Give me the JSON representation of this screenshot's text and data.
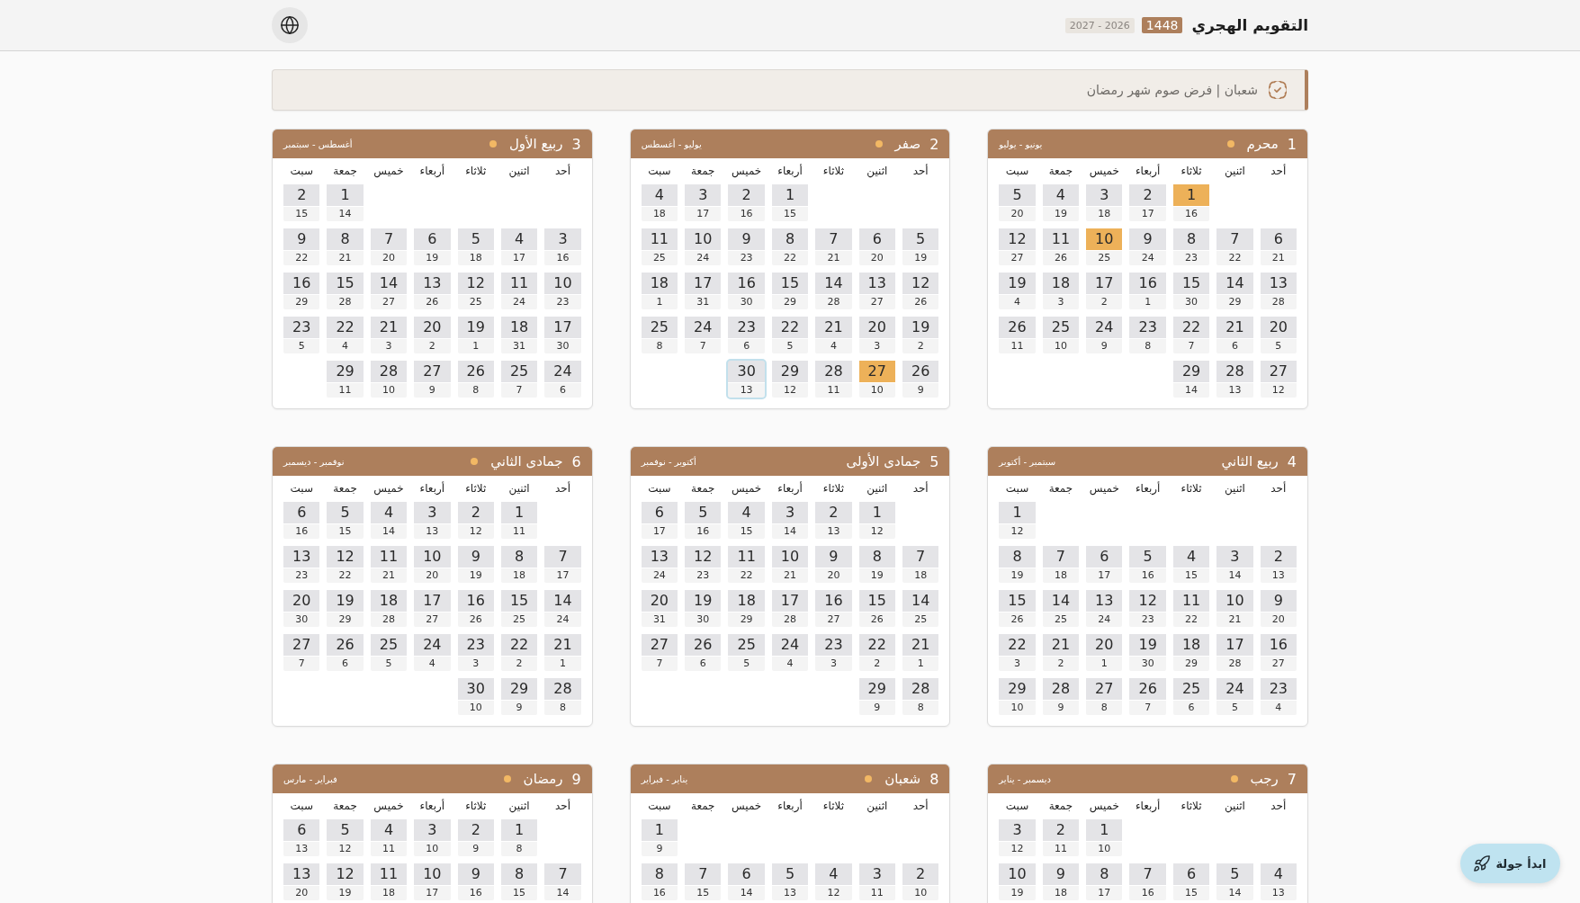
{
  "header": {
    "title": "التقويم الهجري",
    "hijri_year": "1448",
    "gregorian_years": "2026 - 2027"
  },
  "banner": {
    "text": "شعبان | فرض صوم شهر رمضان"
  },
  "months": [
    {
      "number": "1",
      "name": "محرم",
      "marked": true,
      "gregorian_range": "يونيو - يوليو",
      "weekdays": [
        "أحد",
        "اثنين",
        "ثلاثاء",
        "أربعاء",
        "خميس",
        "جمعة",
        "سبت"
      ],
      "weeks": [
        [
          {
            "hijri": "1",
            "gregorian": "16",
            "kind": "event"
          },
          {
            "hijri": "2",
            "gregorian": "17",
            "kind": "day"
          },
          {
            "hijri": "3",
            "gregorian": "18",
            "kind": "day"
          },
          {
            "hijri": "4",
            "gregorian": "19",
            "kind": "day"
          },
          {
            "hijri": "5",
            "gregorian": "20",
            "kind": "day"
          }
        ],
        [
          {
            "hijri": "6",
            "gregorian": "21",
            "kind": "day"
          },
          {
            "hijri": "7",
            "gregorian": "22",
            "kind": "day"
          },
          {
            "hijri": "8",
            "gregorian": "23",
            "kind": "day"
          },
          {
            "hijri": "9",
            "gregorian": "24",
            "kind": "day"
          },
          {
            "hijri": "10",
            "gregorian": "25",
            "kind": "event"
          },
          {
            "hijri": "11",
            "gregorian": "26",
            "kind": "day"
          },
          {
            "hijri": "12",
            "gregorian": "27",
            "kind": "day"
          }
        ],
        [
          {
            "hijri": "13",
            "gregorian": "28",
            "kind": "day"
          },
          {
            "hijri": "14",
            "gregorian": "29",
            "kind": "day"
          },
          {
            "hijri": "15",
            "gregorian": "30",
            "kind": "day"
          },
          {
            "hijri": "16",
            "gregorian": "1",
            "kind": "day"
          },
          {
            "hijri": "17",
            "gregorian": "2",
            "kind": "day"
          },
          {
            "hijri": "18",
            "gregorian": "3",
            "kind": "day"
          },
          {
            "hijri": "19",
            "gregorian": "4",
            "kind": "day"
          }
        ],
        [
          {
            "hijri": "20",
            "gregorian": "5",
            "kind": "day"
          },
          {
            "hijri": "21",
            "gregorian": "6",
            "kind": "day"
          },
          {
            "hijri": "22",
            "gregorian": "7",
            "kind": "day"
          },
          {
            "hijri": "23",
            "gregorian": "8",
            "kind": "day"
          },
          {
            "hijri": "24",
            "gregorian": "9",
            "kind": "day"
          },
          {
            "hijri": "25",
            "gregorian": "10",
            "kind": "day"
          },
          {
            "hijri": "26",
            "gregorian": "11",
            "kind": "day"
          }
        ],
        [
          {
            "hijri": "27",
            "gregorian": "12",
            "kind": "day"
          },
          {
            "hijri": "28",
            "gregorian": "13",
            "kind": "day"
          },
          {
            "hijri": "29",
            "gregorian": "14",
            "kind": "day"
          }
        ]
      ]
    },
    {
      "number": "2",
      "name": "صفر",
      "marked": true,
      "gregorian_range": "يوليو - أغسطس",
      "weekdays": [
        "أحد",
        "اثنين",
        "ثلاثاء",
        "أربعاء",
        "خميس",
        "جمعة",
        "سبت"
      ],
      "weeks": [
        [
          {
            "hijri": "1",
            "gregorian": "15",
            "kind": "day"
          },
          {
            "hijri": "2",
            "gregorian": "16",
            "kind": "day"
          },
          {
            "hijri": "3",
            "gregorian": "17",
            "kind": "day"
          },
          {
            "hijri": "4",
            "gregorian": "18",
            "kind": "day"
          }
        ],
        [
          {
            "hijri": "5",
            "gregorian": "19",
            "kind": "day"
          },
          {
            "hijri": "6",
            "gregorian": "20",
            "kind": "day"
          },
          {
            "hijri": "7",
            "gregorian": "21",
            "kind": "day"
          },
          {
            "hijri": "8",
            "gregorian": "22",
            "kind": "day"
          },
          {
            "hijri": "9",
            "gregorian": "23",
            "kind": "day"
          },
          {
            "hijri": "10",
            "gregorian": "24",
            "kind": "day"
          },
          {
            "hijri": "11",
            "gregorian": "25",
            "kind": "day"
          }
        ],
        [
          {
            "hijri": "12",
            "gregorian": "26",
            "kind": "day"
          },
          {
            "hijri": "13",
            "gregorian": "27",
            "kind": "day"
          },
          {
            "hijri": "14",
            "gregorian": "28",
            "kind": "day"
          },
          {
            "hijri": "15",
            "gregorian": "29",
            "kind": "day"
          },
          {
            "hijri": "16",
            "gregorian": "30",
            "kind": "day"
          },
          {
            "hijri": "17",
            "gregorian": "31",
            "kind": "day"
          },
          {
            "hijri": "18",
            "gregorian": "1",
            "kind": "day"
          }
        ],
        [
          {
            "hijri": "19",
            "gregorian": "2",
            "kind": "day"
          },
          {
            "hijri": "20",
            "gregorian": "3",
            "kind": "day"
          },
          {
            "hijri": "21",
            "gregorian": "4",
            "kind": "day"
          },
          {
            "hijri": "22",
            "gregorian": "5",
            "kind": "day"
          },
          {
            "hijri": "23",
            "gregorian": "6",
            "kind": "day"
          },
          {
            "hijri": "24",
            "gregorian": "7",
            "kind": "day"
          },
          {
            "hijri": "25",
            "gregorian": "8",
            "kind": "day"
          }
        ],
        [
          {
            "hijri": "26",
            "gregorian": "9",
            "kind": "day"
          },
          {
            "hijri": "27",
            "gregorian": "10",
            "kind": "event"
          },
          {
            "hijri": "28",
            "gregorian": "11",
            "kind": "day"
          },
          {
            "hijri": "29",
            "gregorian": "12",
            "kind": "day"
          },
          {
            "hijri": "30",
            "gregorian": "13",
            "kind": "today"
          }
        ]
      ]
    },
    {
      "number": "3",
      "name": "ربيع الأول",
      "marked": true,
      "gregorian_range": "أغسطس - سبتمبر",
      "weekdays": [
        "أحد",
        "اثنين",
        "ثلاثاء",
        "أربعاء",
        "خميس",
        "جمعة",
        "سبت"
      ],
      "weeks": [
        [
          {
            "hijri": "1",
            "gregorian": "14",
            "kind": "day"
          },
          {
            "hijri": "2",
            "gregorian": "15",
            "kind": "day"
          }
        ],
        [
          {
            "hijri": "3",
            "gregorian": "16",
            "kind": "day"
          },
          {
            "hijri": "4",
            "gregorian": "17",
            "kind": "day"
          },
          {
            "hijri": "5",
            "gregorian": "18",
            "kind": "day"
          },
          {
            "hijri": "6",
            "gregorian": "19",
            "kind": "day"
          },
          {
            "hijri": "7",
            "gregorian": "20",
            "kind": "day"
          },
          {
            "hijri": "8",
            "gregorian": "21",
            "kind": "day"
          },
          {
            "hijri": "9",
            "gregorian": "22",
            "kind": "day"
          }
        ],
        [
          {
            "hijri": "10",
            "gregorian": "23",
            "kind": "day"
          },
          {
            "hijri": "11",
            "gregorian": "24",
            "kind": "day"
          },
          {
            "hijri": "12",
            "gregorian": "25",
            "kind": "day"
          },
          {
            "hijri": "13",
            "gregorian": "26",
            "kind": "day"
          },
          {
            "hijri": "14",
            "gregorian": "27",
            "kind": "day"
          },
          {
            "hijri": "15",
            "gregorian": "28",
            "kind": "day"
          },
          {
            "hijri": "16",
            "gregorian": "29",
            "kind": "day"
          }
        ],
        [
          {
            "hijri": "17",
            "gregorian": "30",
            "kind": "day"
          },
          {
            "hijri": "18",
            "gregorian": "31",
            "kind": "day"
          },
          {
            "hijri": "19",
            "gregorian": "1",
            "kind": "day"
          },
          {
            "hijri": "20",
            "gregorian": "2",
            "kind": "day"
          },
          {
            "hijri": "21",
            "gregorian": "3",
            "kind": "day"
          },
          {
            "hijri": "22",
            "gregorian": "4",
            "kind": "day"
          },
          {
            "hijri": "23",
            "gregorian": "5",
            "kind": "day"
          }
        ],
        [
          {
            "hijri": "24",
            "gregorian": "6",
            "kind": "day"
          },
          {
            "hijri": "25",
            "gregorian": "7",
            "kind": "day"
          },
          {
            "hijri": "26",
            "gregorian": "8",
            "kind": "day"
          },
          {
            "hijri": "27",
            "gregorian": "9",
            "kind": "day"
          },
          {
            "hijri": "28",
            "gregorian": "10",
            "kind": "day"
          },
          {
            "hijri": "29",
            "gregorian": "11",
            "kind": "day"
          }
        ]
      ]
    },
    {
      "number": "4",
      "name": "ربيع الثاني",
      "marked": false,
      "gregorian_range": "سبتمبر - أكتوبر",
      "weekdays": [
        "أحد",
        "اثنين",
        "ثلاثاء",
        "أربعاء",
        "خميس",
        "جمعة",
        "سبت"
      ],
      "weeks": [
        [
          {
            "hijri": "1",
            "gregorian": "12",
            "kind": "day"
          }
        ],
        [
          {
            "hijri": "2",
            "gregorian": "13",
            "kind": "day"
          },
          {
            "hijri": "3",
            "gregorian": "14",
            "kind": "day"
          },
          {
            "hijri": "4",
            "gregorian": "15",
            "kind": "day"
          },
          {
            "hijri": "5",
            "gregorian": "16",
            "kind": "day"
          },
          {
            "hijri": "6",
            "gregorian": "17",
            "kind": "day"
          },
          {
            "hijri": "7",
            "gregorian": "18",
            "kind": "day"
          },
          {
            "hijri": "8",
            "gregorian": "19",
            "kind": "day"
          }
        ],
        [
          {
            "hijri": "9",
            "gregorian": "20",
            "kind": "day"
          },
          {
            "hijri": "10",
            "gregorian": "21",
            "kind": "day"
          },
          {
            "hijri": "11",
            "gregorian": "22",
            "kind": "day"
          },
          {
            "hijri": "12",
            "gregorian": "23",
            "kind": "day"
          },
          {
            "hijri": "13",
            "gregorian": "24",
            "kind": "day"
          },
          {
            "hijri": "14",
            "gregorian": "25",
            "kind": "day"
          },
          {
            "hijri": "15",
            "gregorian": "26",
            "kind": "day"
          }
        ],
        [
          {
            "hijri": "16",
            "gregorian": "27",
            "kind": "day"
          },
          {
            "hijri": "17",
            "gregorian": "28",
            "kind": "day"
          },
          {
            "hijri": "18",
            "gregorian": "29",
            "kind": "day"
          },
          {
            "hijri": "19",
            "gregorian": "30",
            "kind": "day"
          },
          {
            "hijri": "20",
            "gregorian": "1",
            "kind": "day"
          },
          {
            "hijri": "21",
            "gregorian": "2",
            "kind": "day"
          },
          {
            "hijri": "22",
            "gregorian": "3",
            "kind": "day"
          }
        ],
        [
          {
            "hijri": "23",
            "gregorian": "4",
            "kind": "day"
          },
          {
            "hijri": "24",
            "gregorian": "5",
            "kind": "day"
          },
          {
            "hijri": "25",
            "gregorian": "6",
            "kind": "day"
          },
          {
            "hijri": "26",
            "gregorian": "7",
            "kind": "day"
          },
          {
            "hijri": "27",
            "gregorian": "8",
            "kind": "day"
          },
          {
            "hijri": "28",
            "gregorian": "9",
            "kind": "day"
          },
          {
            "hijri": "29",
            "gregorian": "10",
            "kind": "day"
          }
        ]
      ]
    },
    {
      "number": "5",
      "name": "جمادى الأولى",
      "marked": false,
      "gregorian_range": "أكتوبر - نوفمبر",
      "weekdays": [
        "أحد",
        "اثنين",
        "ثلاثاء",
        "أربعاء",
        "خميس",
        "جمعة",
        "سبت"
      ],
      "weeks": [
        [
          {
            "hijri": "1",
            "gregorian": "12",
            "kind": "day"
          },
          {
            "hijri": "2",
            "gregorian": "13",
            "kind": "day"
          },
          {
            "hijri": "3",
            "gregorian": "14",
            "kind": "day"
          },
          {
            "hijri": "4",
            "gregorian": "15",
            "kind": "day"
          },
          {
            "hijri": "5",
            "gregorian": "16",
            "kind": "day"
          },
          {
            "hijri": "6",
            "gregorian": "17",
            "kind": "day"
          }
        ],
        [
          {
            "hijri": "7",
            "gregorian": "18",
            "kind": "day"
          },
          {
            "hijri": "8",
            "gregorian": "19",
            "kind": "day"
          },
          {
            "hijri": "9",
            "gregorian": "20",
            "kind": "day"
          },
          {
            "hijri": "10",
            "gregorian": "21",
            "kind": "day"
          },
          {
            "hijri": "11",
            "gregorian": "22",
            "kind": "day"
          },
          {
            "hijri": "12",
            "gregorian": "23",
            "kind": "day"
          },
          {
            "hijri": "13",
            "gregorian": "24",
            "kind": "day"
          }
        ],
        [
          {
            "hijri": "14",
            "gregorian": "25",
            "kind": "day"
          },
          {
            "hijri": "15",
            "gregorian": "26",
            "kind": "day"
          },
          {
            "hijri": "16",
            "gregorian": "27",
            "kind": "day"
          },
          {
            "hijri": "17",
            "gregorian": "28",
            "kind": "day"
          },
          {
            "hijri": "18",
            "gregorian": "29",
            "kind": "day"
          },
          {
            "hijri": "19",
            "gregorian": "30",
            "kind": "day"
          },
          {
            "hijri": "20",
            "gregorian": "31",
            "kind": "day"
          }
        ],
        [
          {
            "hijri": "21",
            "gregorian": "1",
            "kind": "day"
          },
          {
            "hijri": "22",
            "gregorian": "2",
            "kind": "day"
          },
          {
            "hijri": "23",
            "gregorian": "3",
            "kind": "day"
          },
          {
            "hijri": "24",
            "gregorian": "4",
            "kind": "day"
          },
          {
            "hijri": "25",
            "gregorian": "5",
            "kind": "day"
          },
          {
            "hijri": "26",
            "gregorian": "6",
            "kind": "day"
          },
          {
            "hijri": "27",
            "gregorian": "7",
            "kind": "day"
          }
        ],
        [
          {
            "hijri": "28",
            "gregorian": "8",
            "kind": "day"
          },
          {
            "hijri": "29",
            "gregorian": "9",
            "kind": "day"
          }
        ]
      ]
    },
    {
      "number": "6",
      "name": "جمادى الثاني",
      "marked": true,
      "gregorian_range": "نوفمبر - ديسمبر",
      "weekdays": [
        "أحد",
        "اثنين",
        "ثلاثاء",
        "أربعاء",
        "خميس",
        "جمعة",
        "سبت"
      ],
      "weeks": [
        [
          {
            "hijri": "1",
            "gregorian": "11",
            "kind": "day"
          },
          {
            "hijri": "2",
            "gregorian": "12",
            "kind": "day"
          },
          {
            "hijri": "3",
            "gregorian": "13",
            "kind": "day"
          },
          {
            "hijri": "4",
            "gregorian": "14",
            "kind": "day"
          },
          {
            "hijri": "5",
            "gregorian": "15",
            "kind": "day"
          },
          {
            "hijri": "6",
            "gregorian": "16",
            "kind": "day"
          }
        ],
        [
          {
            "hijri": "7",
            "gregorian": "17",
            "kind": "day"
          },
          {
            "hijri": "8",
            "gregorian": "18",
            "kind": "day"
          },
          {
            "hijri": "9",
            "gregorian": "19",
            "kind": "day"
          },
          {
            "hijri": "10",
            "gregorian": "20",
            "kind": "day"
          },
          {
            "hijri": "11",
            "gregorian": "21",
            "kind": "day"
          },
          {
            "hijri": "12",
            "gregorian": "22",
            "kind": "day"
          },
          {
            "hijri": "13",
            "gregorian": "23",
            "kind": "day"
          }
        ],
        [
          {
            "hijri": "14",
            "gregorian": "24",
            "kind": "day"
          },
          {
            "hijri": "15",
            "gregorian": "25",
            "kind": "day"
          },
          {
            "hijri": "16",
            "gregorian": "26",
            "kind": "day"
          },
          {
            "hijri": "17",
            "gregorian": "27",
            "kind": "day"
          },
          {
            "hijri": "18",
            "gregorian": "28",
            "kind": "day"
          },
          {
            "hijri": "19",
            "gregorian": "29",
            "kind": "day"
          },
          {
            "hijri": "20",
            "gregorian": "30",
            "kind": "day"
          }
        ],
        [
          {
            "hijri": "21",
            "gregorian": "1",
            "kind": "day"
          },
          {
            "hijri": "22",
            "gregorian": "2",
            "kind": "day"
          },
          {
            "hijri": "23",
            "gregorian": "3",
            "kind": "day"
          },
          {
            "hijri": "24",
            "gregorian": "4",
            "kind": "day"
          },
          {
            "hijri": "25",
            "gregorian": "5",
            "kind": "day"
          },
          {
            "hijri": "26",
            "gregorian": "6",
            "kind": "day"
          },
          {
            "hijri": "27",
            "gregorian": "7",
            "kind": "day"
          }
        ],
        [
          {
            "hijri": "28",
            "gregorian": "8",
            "kind": "day"
          },
          {
            "hijri": "29",
            "gregorian": "9",
            "kind": "day"
          },
          {
            "hijri": "30",
            "gregorian": "10",
            "kind": "day"
          }
        ]
      ]
    },
    {
      "number": "7",
      "name": "رجب",
      "marked": true,
      "gregorian_range": "ديسمبر - يناير",
      "weekdays": [
        "أحد",
        "اثنين",
        "ثلاثاء",
        "أربعاء",
        "خميس",
        "جمعة",
        "سبت"
      ],
      "weeks": [
        [
          {
            "hijri": "1",
            "gregorian": "10",
            "kind": "day"
          },
          {
            "hijri": "2",
            "gregorian": "11",
            "kind": "day"
          },
          {
            "hijri": "3",
            "gregorian": "12",
            "kind": "day"
          }
        ],
        [
          {
            "hijri": "4",
            "gregorian": "13",
            "kind": "day"
          },
          {
            "hijri": "5",
            "gregorian": "14",
            "kind": "day"
          },
          {
            "hijri": "6",
            "gregorian": "15",
            "kind": "day"
          },
          {
            "hijri": "7",
            "gregorian": "16",
            "kind": "day"
          },
          {
            "hijri": "8",
            "gregorian": "17",
            "kind": "day"
          },
          {
            "hijri": "9",
            "gregorian": "18",
            "kind": "day"
          },
          {
            "hijri": "10",
            "gregorian": "19",
            "kind": "day"
          }
        ]
      ]
    },
    {
      "number": "8",
      "name": "شعبان",
      "marked": true,
      "gregorian_range": "يناير - فبراير",
      "weekdays": [
        "أحد",
        "اثنين",
        "ثلاثاء",
        "أربعاء",
        "خميس",
        "جمعة",
        "سبت"
      ],
      "weeks": [
        [
          {
            "hijri": "1",
            "gregorian": "9",
            "kind": "day"
          }
        ],
        [
          {
            "hijri": "2",
            "gregorian": "10",
            "kind": "day"
          },
          {
            "hijri": "3",
            "gregorian": "11",
            "kind": "day"
          },
          {
            "hijri": "4",
            "gregorian": "12",
            "kind": "day"
          },
          {
            "hijri": "5",
            "gregorian": "13",
            "kind": "day"
          },
          {
            "hijri": "6",
            "gregorian": "14",
            "kind": "day"
          },
          {
            "hijri": "7",
            "gregorian": "15",
            "kind": "day"
          },
          {
            "hijri": "8",
            "gregorian": "16",
            "kind": "day"
          }
        ]
      ]
    },
    {
      "number": "9",
      "name": "رمضان",
      "marked": true,
      "gregorian_range": "فبراير - مارس",
      "weekdays": [
        "أحد",
        "اثنين",
        "ثلاثاء",
        "أربعاء",
        "خميس",
        "جمعة",
        "سبت"
      ],
      "weeks": [
        [
          {
            "hijri": "1",
            "gregorian": "8",
            "kind": "day"
          },
          {
            "hijri": "2",
            "gregorian": "9",
            "kind": "day"
          },
          {
            "hijri": "3",
            "gregorian": "10",
            "kind": "day"
          },
          {
            "hijri": "4",
            "gregorian": "11",
            "kind": "day"
          },
          {
            "hijri": "5",
            "gregorian": "12",
            "kind": "day"
          },
          {
            "hijri": "6",
            "gregorian": "13",
            "kind": "day"
          }
        ],
        [
          {
            "hijri": "7",
            "gregorian": "14",
            "kind": "day"
          },
          {
            "hijri": "8",
            "gregorian": "15",
            "kind": "day"
          },
          {
            "hijri": "9",
            "gregorian": "16",
            "kind": "day"
          },
          {
            "hijri": "10",
            "gregorian": "17",
            "kind": "day"
          },
          {
            "hijri": "11",
            "gregorian": "18",
            "kind": "day"
          },
          {
            "hijri": "12",
            "gregorian": "19",
            "kind": "day"
          },
          {
            "hijri": "13",
            "gregorian": "20",
            "kind": "day"
          }
        ]
      ]
    }
  ],
  "tour_button": {
    "label": "ابدأ جولة"
  }
}
